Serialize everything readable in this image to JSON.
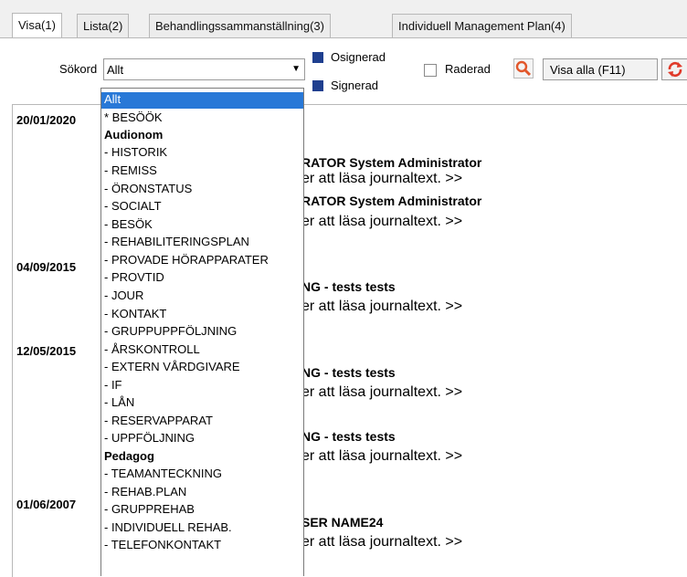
{
  "tabs": [
    {
      "label": "Visa(1)"
    },
    {
      "label": "Lista(2)"
    },
    {
      "label": "Behandlingssammanställning(3)"
    },
    {
      "label": "Individuell Management Plan(4)"
    }
  ],
  "toolbar": {
    "sokord_label": "Sökord",
    "sokord_value": "Allt",
    "osignerad_label": "Osignerad",
    "signerad_label": "Signerad",
    "raderad_label": "Raderad",
    "visa_alla_label": "Visa alla (F11)"
  },
  "journal": {
    "dates": [
      "20/01/2020",
      "04/09/2015",
      "12/05/2015",
      "01/06/2007"
    ],
    "entries": [
      {
        "title": "RATOR System Administrator",
        "text": "er att läsa journaltext. >>"
      },
      {
        "title": "RATOR System Administrator",
        "text": "er att läsa journaltext. >>"
      },
      {
        "title": "NG - tests tests",
        "text": "er att läsa journaltext. >>"
      },
      {
        "title": "NG - tests tests",
        "text": "er att läsa journaltext. >>"
      },
      {
        "title": "NG - tests tests",
        "text": "er att läsa journaltext. >>"
      },
      {
        "title": "SER NAME24",
        "text": "er att läsa journaltext. >>"
      }
    ]
  },
  "dropdown": {
    "items": [
      {
        "label": "Allt"
      },
      {
        "label": "* BESÖÖK"
      },
      {
        "label": "Audionom"
      },
      {
        "label": "- HISTORIK"
      },
      {
        "label": "- REMISS"
      },
      {
        "label": "- ÖRONSTATUS"
      },
      {
        "label": "- SOCIALT"
      },
      {
        "label": "- BESÖK"
      },
      {
        "label": "- REHABILITERINGSPLAN"
      },
      {
        "label": "- PROVADE HÖRAPPARATER"
      },
      {
        "label": "- PROVTID"
      },
      {
        "label": "- JOUR"
      },
      {
        "label": "- KONTAKT"
      },
      {
        "label": "- GRUPPUPPFÖLJNING"
      },
      {
        "label": "- ÅRSKONTROLL"
      },
      {
        "label": "- EXTERN VÅRDGIVARE"
      },
      {
        "label": "- IF"
      },
      {
        "label": "- LÅN"
      },
      {
        "label": "- RESERVAPPARAT"
      },
      {
        "label": "- UPPFÖLJNING"
      },
      {
        "label": "Pedagog"
      },
      {
        "label": "- TEAMANTECKNING"
      },
      {
        "label": "- REHAB.PLAN"
      },
      {
        "label": "- GRUPPREHAB"
      },
      {
        "label": "- INDIVIDUELL REHAB."
      },
      {
        "label": "- TELEFONKONTAKT"
      }
    ]
  },
  "colors": {
    "accent": "#2878d7",
    "checkbox_fill": "#1f3f8f",
    "search_icon": "#e2572b",
    "refresh_icon": "#e03a2a"
  }
}
